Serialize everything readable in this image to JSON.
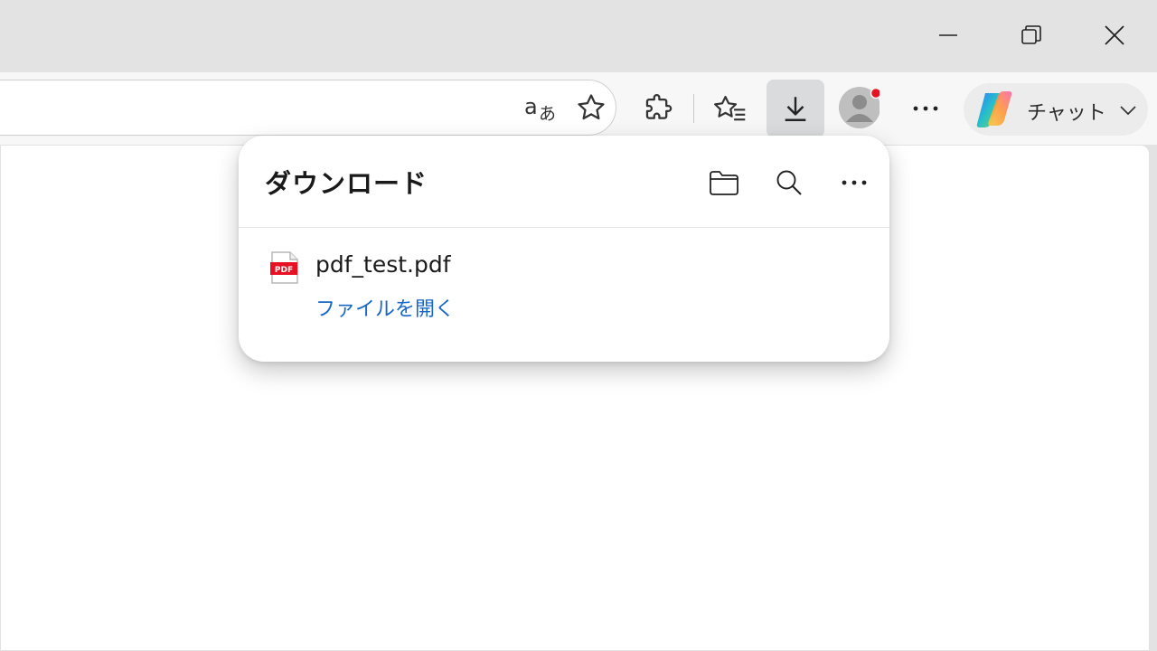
{
  "window_controls": {
    "minimize_icon": "minimize-icon",
    "restore_icon": "restore-icon",
    "close_icon": "close-icon"
  },
  "toolbar": {
    "read_aloud_icon": "read-aloud-icon",
    "favorite_icon": "star-icon",
    "extensions_icon": "puzzle-icon",
    "favorites_icon": "favorites-list-icon",
    "downloads_icon": "download-icon",
    "profile_icon": "profile-avatar-icon",
    "profile_badge_color": "#e81123",
    "more_icon": "more-icon",
    "copilot_label": "チャット",
    "copilot_icon": "copilot-icon",
    "copilot_chevron_icon": "chevron-down-icon"
  },
  "downloads_panel": {
    "title": "ダウンロード",
    "open_folder_icon": "folder-icon",
    "search_icon": "search-icon",
    "more_icon": "more-icon",
    "items": [
      {
        "file_name": "pdf_test.pdf",
        "file_icon": "pdf-file-icon",
        "pdf_badge": "PDF",
        "action_label": "ファイルを開く",
        "action_color": "#1767c9"
      }
    ]
  }
}
